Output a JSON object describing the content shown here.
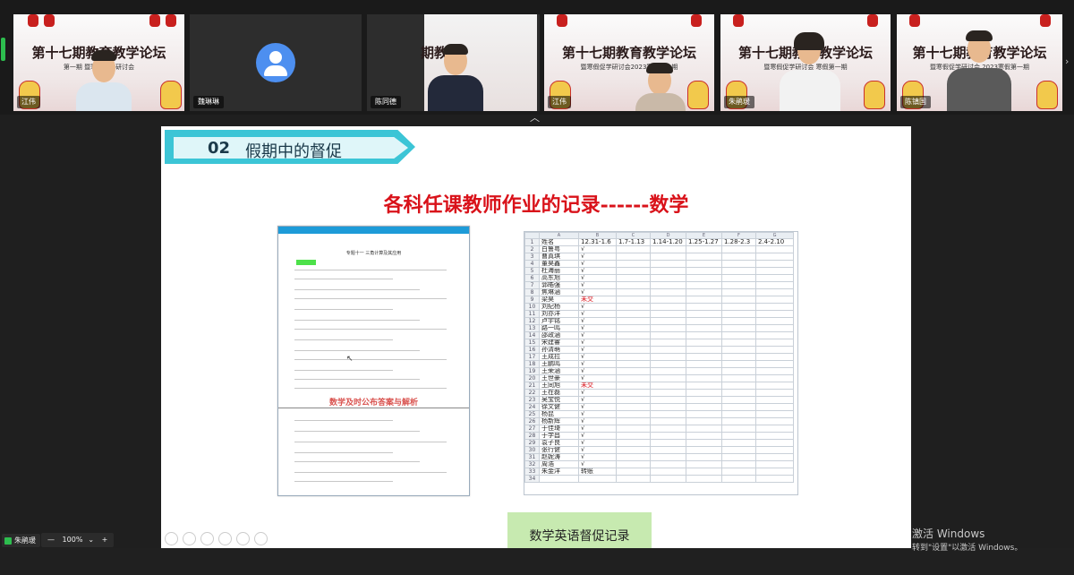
{
  "meeting": {
    "participants": [
      {
        "name": "江伟",
        "banner": "第十七期教育教学论坛",
        "sub": "第一期 暨寒假促学研讨会"
      },
      {
        "name": "魏琳琳",
        "video_off": true
      },
      {
        "name": "陈同德",
        "banner": "期教育"
      },
      {
        "name": "江伟",
        "banner": "第十七期教育教学论坛",
        "sub": "暨寒假促学研讨会2023寒假第一期"
      },
      {
        "name": "朱鹃瑗",
        "banner": "第十七期教育教学论坛",
        "sub": "暨寒假促学研讨会 寒假第一期"
      },
      {
        "name": "陈镇国",
        "banner": "第十七期教育教学论坛",
        "sub": "暨寒假促学研讨会 2023寒假第一期"
      }
    ],
    "local_user": "朱鹃瑗",
    "zoom_level": "100%",
    "zoom_minus": "—",
    "zoom_plus": "+",
    "expand_icon": "chevron-up-icon",
    "colors": {
      "accent_green": "#2dbd4e",
      "slide_red": "#d9121a",
      "ribbon": "#3cc5d6"
    }
  },
  "slide": {
    "section_number": "02",
    "section_title": "假期中的督促",
    "title": "各科任课教师作业的记录------数学",
    "doc_title": "专题十一 三角计算及其应用",
    "doc_caption": "数学及时公布答案与解析",
    "badge": "数学英语督促记录",
    "sheet": {
      "col_letters": [
        "",
        "A",
        "B",
        "C",
        "D",
        "E",
        "F",
        "G"
      ],
      "header": [
        "姓名",
        "12.31-1.6",
        "1.7-1.13",
        "1.14-1.20",
        "1.25-1.27",
        "1.28-2.3",
        "2.4-2.10"
      ],
      "rows": [
        {
          "n": "2",
          "name": "白鲁粤",
          "mark": "√"
        },
        {
          "n": "3",
          "name": "曹真琪",
          "mark": "√"
        },
        {
          "n": "4",
          "name": "董昊鑫",
          "mark": "√"
        },
        {
          "n": "5",
          "name": "杜海丽",
          "mark": "√"
        },
        {
          "n": "6",
          "name": "高东旭",
          "mark": "√"
        },
        {
          "n": "7",
          "name": "郭皓强",
          "mark": "√"
        },
        {
          "n": "8",
          "name": "焦琳涵",
          "mark": "√"
        },
        {
          "n": "9",
          "name": "梁昊",
          "mark": "未交",
          "red": true
        },
        {
          "n": "10",
          "name": "刘纪杨",
          "mark": "√"
        },
        {
          "n": "11",
          "name": "刘亦洋",
          "mark": "√"
        },
        {
          "n": "12",
          "name": "卢宇铭",
          "mark": "√"
        },
        {
          "n": "13",
          "name": "路一鸣",
          "mark": "√"
        },
        {
          "n": "14",
          "name": "邵政涵",
          "mark": "√"
        },
        {
          "n": "15",
          "name": "宋建睿",
          "mark": "√"
        },
        {
          "n": "16",
          "name": "孙清萌",
          "mark": "√"
        },
        {
          "n": "17",
          "name": "王成拉",
          "mark": "√"
        },
        {
          "n": "18",
          "name": "王鹏鸣",
          "mark": "√"
        },
        {
          "n": "19",
          "name": "王荣涵",
          "mark": "√"
        },
        {
          "n": "20",
          "name": "王世豪",
          "mark": "√"
        },
        {
          "n": "21",
          "name": "王同旭",
          "mark": "未交",
          "red": true
        },
        {
          "n": "22",
          "name": "王在磊",
          "mark": "√"
        },
        {
          "n": "23",
          "name": "吴宝悦",
          "mark": "√"
        },
        {
          "n": "24",
          "name": "徐文健",
          "mark": "√"
        },
        {
          "n": "25",
          "name": "杨昆",
          "mark": "√"
        },
        {
          "n": "26",
          "name": "杨新辉",
          "mark": "√"
        },
        {
          "n": "27",
          "name": "于佳琦",
          "mark": "√"
        },
        {
          "n": "28",
          "name": "于学昌",
          "mark": "√"
        },
        {
          "n": "29",
          "name": "袁子良",
          "mark": "√"
        },
        {
          "n": "30",
          "name": "张行健",
          "mark": "√"
        },
        {
          "n": "31",
          "name": "赵妮涛",
          "mark": "√"
        },
        {
          "n": "32",
          "name": "周浩",
          "mark": "√"
        },
        {
          "n": "33",
          "name": "朱金洋",
          "mark": "转账"
        }
      ]
    }
  },
  "windows_watermark": {
    "line1": "激活 Windows",
    "line2": "转到\"设置\"以激活 Windows。"
  }
}
